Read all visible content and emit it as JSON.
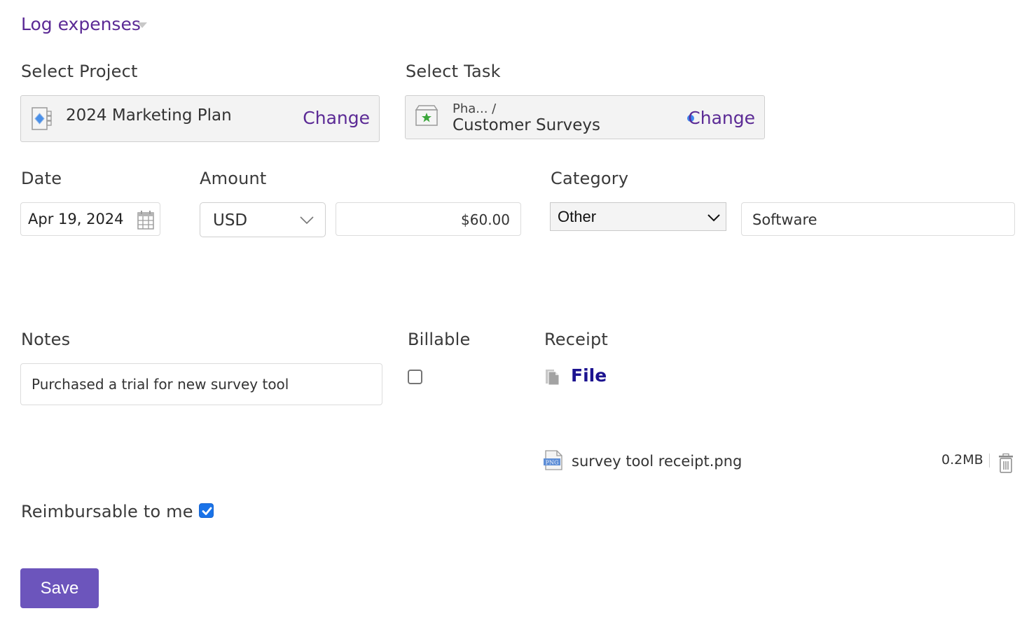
{
  "header": {
    "title": "Log expenses",
    "caret_icon": "caret-down-icon"
  },
  "project": {
    "label": "Select Project",
    "name": "2024 Marketing Plan",
    "icon": "project-plan-icon",
    "change_label": "Change"
  },
  "task": {
    "label": "Select Task",
    "parent": "Pha...  /",
    "name": "Customer Surveys",
    "icon": "task-star-icon",
    "change_label": "Change"
  },
  "date": {
    "label": "Date",
    "value": "Apr 19, 2024",
    "icon": "calendar-icon"
  },
  "amount": {
    "label": "Amount",
    "currency": "USD",
    "value": "$60.00"
  },
  "category": {
    "label": "Category",
    "selected": "Other",
    "subcategory": "Software"
  },
  "notes": {
    "label": "Notes",
    "value": "Purchased a trial for new survey tool"
  },
  "billable": {
    "label": "Billable",
    "checked": false
  },
  "receipt": {
    "label": "Receipt",
    "file_link": "File",
    "attachment": {
      "name": "survey tool receipt.png",
      "type": "PNG",
      "size": "0.2MB"
    }
  },
  "reimbursable": {
    "label": "Reimbursable to me",
    "checked": true
  },
  "actions": {
    "save_label": "Save"
  },
  "colors": {
    "accent_purple": "#5b2a95",
    "save_button": "#6c55bc",
    "file_link": "#1c1390",
    "checkbox_checked": "#1a73e8"
  }
}
